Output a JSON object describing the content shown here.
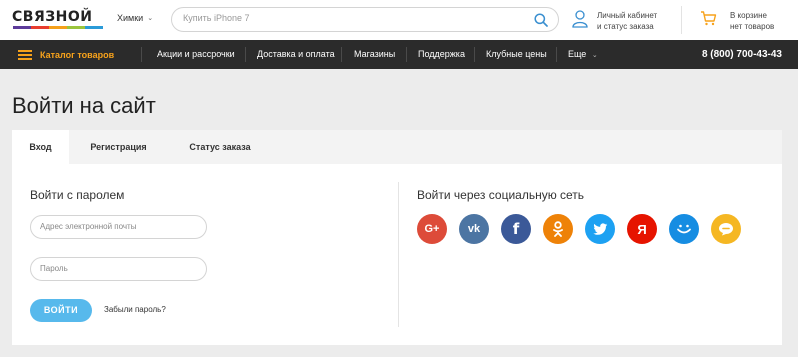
{
  "header": {
    "logo": "СВЯЗНОЙ",
    "city": "Химки",
    "search_placeholder": "Купить iPhone 7",
    "account_line1": "Личный кабинет",
    "account_line2": "и статус заказа",
    "cart_line1": "В корзине",
    "cart_line2": "нет товаров"
  },
  "nav": {
    "catalog": "Каталог товаров",
    "items": [
      "Акции и рассрочки",
      "Доставка и оплата",
      "Магазины",
      "Поддержка",
      "Клубные цены",
      "Еще"
    ],
    "phone": "8 (800) 700-43-43"
  },
  "page": {
    "title": "Войти на сайт"
  },
  "tabs": [
    "Вход",
    "Регистрация",
    "Статус заказа"
  ],
  "login": {
    "title": "Войти с паролем",
    "email_placeholder": "Адрес электронной почты",
    "password_placeholder": "Пароль",
    "submit": "ВОЙТИ",
    "forgot": "Забыли пароль?"
  },
  "social": {
    "title": "Войти через социальную сеть",
    "networks": [
      {
        "icon": "google-plus-icon",
        "glyph": "G+",
        "color": "#dd4b39"
      },
      {
        "icon": "vk-icon",
        "glyph": "vk",
        "color": "#4c75a3"
      },
      {
        "icon": "facebook-icon",
        "glyph": "f",
        "color": "#3b5998"
      },
      {
        "icon": "odnoklassniki-icon",
        "glyph": "ok",
        "color": "#ee8208"
      },
      {
        "icon": "twitter-icon",
        "glyph": "tw",
        "color": "#1da1f2"
      },
      {
        "icon": "yandex-icon",
        "glyph": "Я",
        "color": "#e61400"
      },
      {
        "icon": "mailru-icon",
        "glyph": "m",
        "color": "#168de2"
      },
      {
        "icon": "chat-icon",
        "glyph": "c",
        "color": "#f5b723"
      }
    ]
  },
  "colors": {
    "accent_orange": "#f7a21b",
    "button_blue": "#57b9ec",
    "nav_bg": "#2b2b2b",
    "logo_stripes": [
      "#5d3b9a",
      "#e83d2f",
      "#f5a01a",
      "#9bc53d",
      "#2b9bd8"
    ]
  }
}
